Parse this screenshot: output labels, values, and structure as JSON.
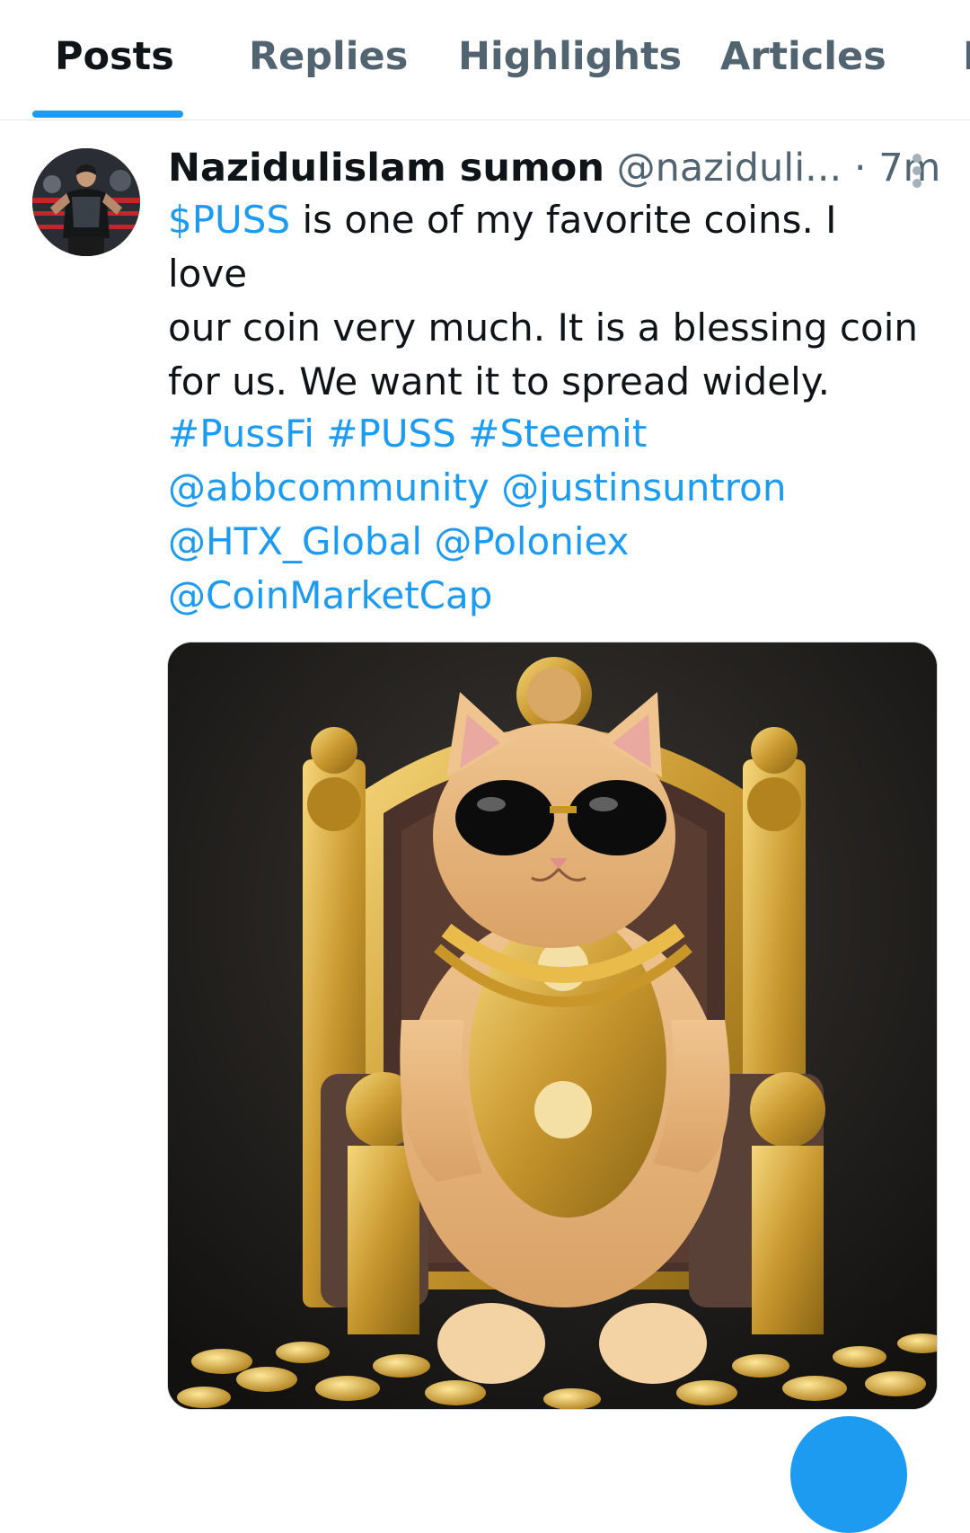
{
  "tabs": [
    {
      "label": "Posts",
      "active": true
    },
    {
      "label": "Replies",
      "active": false
    },
    {
      "label": "Highlights",
      "active": false
    },
    {
      "label": "Articles",
      "active": false
    },
    {
      "label": "M",
      "active": false
    }
  ],
  "post": {
    "display_name": "Nazidulislam sumon",
    "handle": "@naziduli...",
    "separator": " · ",
    "time": "7m",
    "text": {
      "cashtag": "$PUSS",
      "body_line1_rest": " is one of my favorite coins. I love",
      "body_line2": "our coin very much. It is a blessing coin",
      "body_line3": "for us. We want it to spread widely."
    },
    "hashtags": [
      "#PussFi",
      "#PUSS",
      "#Steemit"
    ],
    "mentions": [
      "@abbcommunity",
      "@justinsuntron",
      "@HTX_Global",
      "@Poloniex",
      "@CoinMarketCap"
    ],
    "media_icon": "cat-on-golden-throne-image",
    "avatar_icon": "profile-photo-wrestler"
  },
  "colors": {
    "accent": "#1d9bf0",
    "text_primary": "#0f1419",
    "text_secondary": "#536471",
    "divider": "#e1e6ea"
  }
}
